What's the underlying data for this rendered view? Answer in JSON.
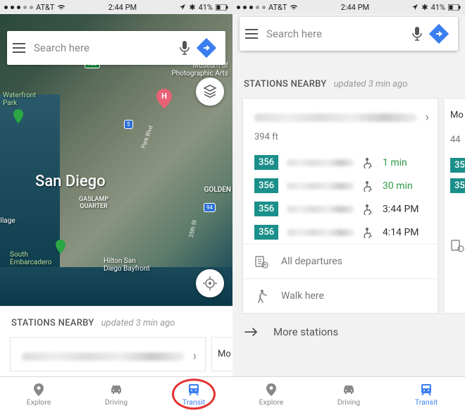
{
  "status": {
    "carrier": "AT&T",
    "time": "2:44 PM",
    "battery": "41%"
  },
  "search": {
    "placeholder": "Search here"
  },
  "map": {
    "city": "San Diego",
    "neighborhoods": {
      "gaslamp": "GASLAMP\nQUARTER",
      "golden": "GOLDEN"
    },
    "poi": {
      "waterfrontPark": "Waterfront\nPark",
      "museumPhoto": "Museum of\nPhotographic Arts",
      "southEmbarcadero": "South\nEmbarcadero",
      "hilton": "Hilton San\nDiego Bayfront",
      "village": "illage"
    },
    "shields": {
      "i5": "5",
      "sr163": "163",
      "sr94": "94"
    },
    "roads": {
      "twentyFifth": "25th St",
      "parkBlvd": "Park Blvd"
    }
  },
  "panel": {
    "title": "STATIONS NEARBY",
    "updated": "updated 3 min ago",
    "station": {
      "distance": "394 ft",
      "routes": [
        {
          "badge": "356",
          "time": "1 min",
          "soon": true
        },
        {
          "badge": "356",
          "time": "30 min",
          "soon": true
        },
        {
          "badge": "356",
          "time": "3:44 PM",
          "soon": false
        },
        {
          "badge": "356",
          "time": "4:14 PM",
          "soon": false
        }
      ],
      "allDepartures": "All departures",
      "walkHere": "Walk here"
    },
    "peek": {
      "name": "Mo",
      "distance": "44",
      "badge": "35"
    },
    "moreStations": "More stations"
  },
  "tabs": {
    "explore": "Explore",
    "driving": "Driving",
    "transit": "Transit"
  }
}
